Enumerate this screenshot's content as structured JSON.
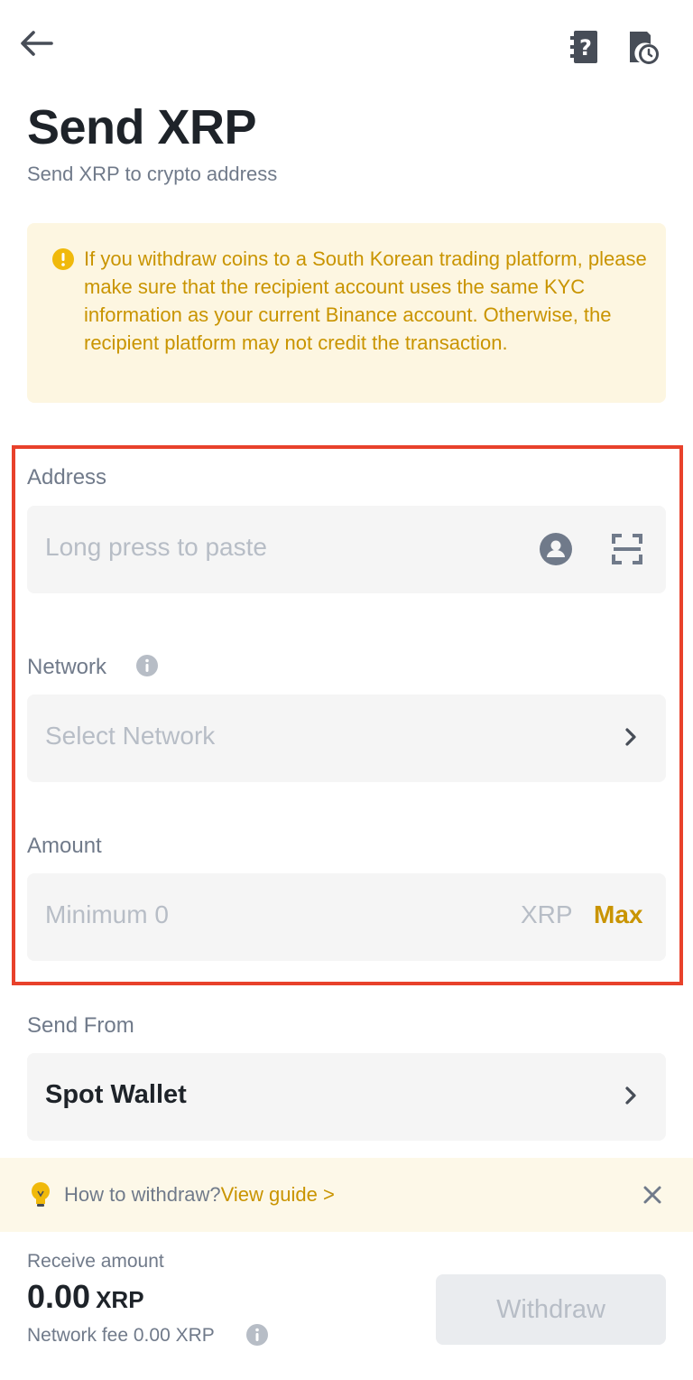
{
  "header": {
    "title": "Send XRP",
    "subtitle": "Send XRP to crypto address"
  },
  "notice": {
    "text": "If you withdraw coins to a South Korean trading platform, please make sure that the recipient account uses the same KYC information as your current Binance account. Otherwise, the recipient platform may not credit the transaction."
  },
  "form": {
    "address": {
      "label": "Address",
      "placeholder": "Long press to paste"
    },
    "network": {
      "label": "Network",
      "placeholder": "Select Network"
    },
    "amount": {
      "label": "Amount",
      "placeholder": "Minimum 0",
      "unit": "XRP",
      "max_label": "Max"
    },
    "send_from": {
      "label": "Send From",
      "value": "Spot Wallet"
    }
  },
  "tip": {
    "text": "How to withdraw?",
    "link": "View guide >"
  },
  "footer": {
    "receive_label": "Receive amount",
    "receive_value": "0.00",
    "receive_unit": "XRP",
    "fee_text": "Network fee 0.00 XRP",
    "withdraw_label": "Withdraw"
  },
  "colors": {
    "accent": "#c99400",
    "highlight_border": "#e8412b",
    "field_bg": "#f5f5f5",
    "notice_bg": "#fdf6e1"
  },
  "icons": [
    "back-arrow-icon",
    "help-document-icon",
    "history-icon",
    "warning-icon",
    "contact-icon",
    "scan-icon",
    "info-icon",
    "chevron-right-icon",
    "lightbulb-icon",
    "close-icon"
  ]
}
